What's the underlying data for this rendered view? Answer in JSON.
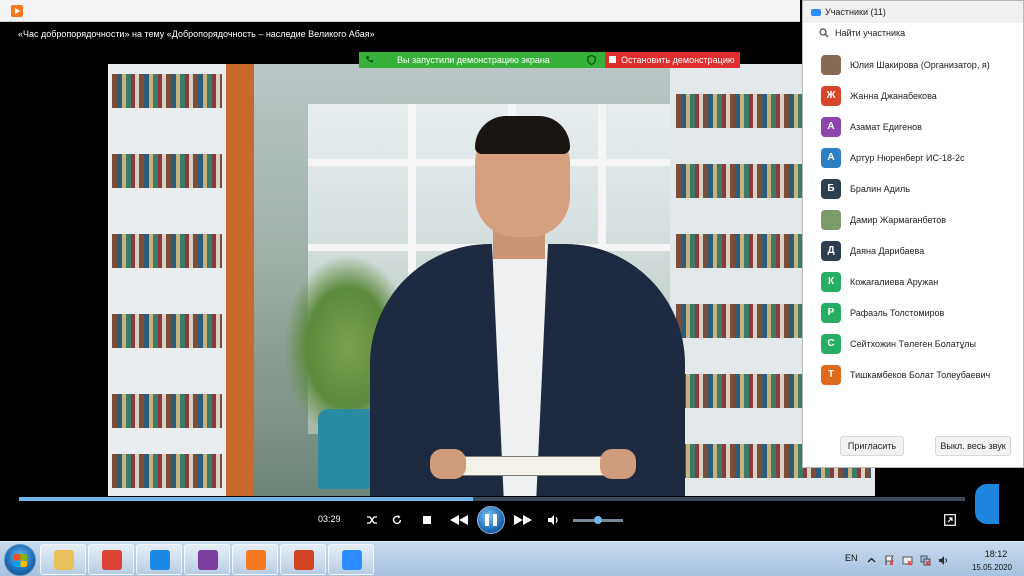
{
  "player": {
    "video_title": "«Час добропорядочности» на тему «Добропорядочность – наследие Великого Абая»",
    "time_elapsed": "03:29",
    "seek_progress": 0.48,
    "volume_level": 0.5
  },
  "share_banner": {
    "status_text": "Вы запустили демонстрацию экрана",
    "stop_label": "Остановить демонстрацию",
    "banner_color": "#38b13a",
    "stop_color": "#e02d2d"
  },
  "participants": {
    "title": "Участники (11)",
    "search_placeholder": "Найти участника",
    "items": [
      {
        "initial": "",
        "name": "Юлия Шакирова (Организатор, я)",
        "color": "#8a6a55"
      },
      {
        "initial": "Ж",
        "name": "Жанна Джанабекова",
        "color": "#d9452b"
      },
      {
        "initial": "А",
        "name": "Азамат Едигенов",
        "color": "#8e44ad"
      },
      {
        "initial": "А",
        "name": "Артур Нюренберг ИС-18-2с",
        "color": "#2c7fc2"
      },
      {
        "initial": "Б",
        "name": "Бралин Адиль",
        "color": "#2c3e50"
      },
      {
        "initial": "",
        "name": "Дамир Жармаганбетов",
        "color": "#7d9a6a"
      },
      {
        "initial": "Д",
        "name": "Даяна Дарибаева",
        "color": "#2c3e50"
      },
      {
        "initial": "К",
        "name": "Кожагалиева Аружан",
        "color": "#27ae60"
      },
      {
        "initial": "Р",
        "name": "Рафаэль Толстомиров",
        "color": "#27ae60"
      },
      {
        "initial": "С",
        "name": "Сейтхожин Төлеген Болатұлы",
        "color": "#27ae60"
      },
      {
        "initial": "Т",
        "name": "Тишкамбеков Болат Толеубаевич",
        "color": "#e06a1b"
      }
    ],
    "invite_label": "Пригласить",
    "mute_all_label": "Выкл. весь звук"
  },
  "taskbar": {
    "apps": [
      {
        "icon": "file-explorer-icon",
        "color": "#e8c15a"
      },
      {
        "icon": "chrome-icon",
        "color": "#db4437"
      },
      {
        "icon": "internet-explorer-icon",
        "color": "#1e88e5"
      },
      {
        "icon": "save-disk-icon",
        "color": "#7b3fa0"
      },
      {
        "icon": "media-player-icon",
        "color": "#f47920"
      },
      {
        "icon": "powerpoint-icon",
        "color": "#d04423"
      },
      {
        "icon": "zoom-icon",
        "color": "#2d8cff"
      }
    ],
    "language": "EN",
    "time": "18:12",
    "date": "15.05.2020"
  }
}
